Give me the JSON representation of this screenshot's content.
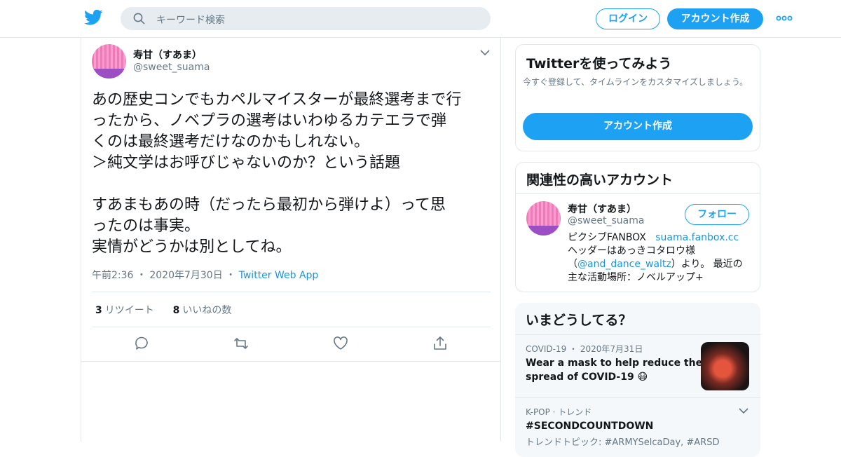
{
  "header": {
    "search_placeholder": "キーワード検索",
    "login_label": "ログイン",
    "signup_label": "アカウント作成"
  },
  "tweet": {
    "display_name": "寿甘（すあま）",
    "handle": "@sweet_suama",
    "text": "あの歴史コンでもカペルマイスターが最終選考まで行\nったから、ノベプラの選考はいわゆるカテエラで弾\nくのは最終選考だけなのかもしれない。\n＞純文学はお呼びじゃないのか？という話題\n\nすあまもあの時（だったら最初から弾けよ）って思\nったのは事実。\n実情がどうかは別としてね。",
    "time": "午前2:36",
    "date": "2020年7月30日",
    "source": "Twitter Web App",
    "retweet_count": "3",
    "retweet_label": "リツイート",
    "like_count": "8",
    "like_label": "いいねの数"
  },
  "sidebar": {
    "try": {
      "title": "Twitterを使ってみよう",
      "description": "今すぐ登録して、タイムラインをカスタマイズしましょう。",
      "button": "アカウント作成"
    },
    "related": {
      "title": "関連性の高いアカウント",
      "name": "寿甘（すあま）",
      "handle": "@sweet_suama",
      "follow_label": "フォロー",
      "bio_prefix": "ピクシブFANBOX",
      "bio_link": "suama.fanbox.cc",
      "bio_line2": "ヘッダーはあっきコタロウ様",
      "bio_open": "（",
      "bio_mention": "@and_dance_waltz",
      "bio_after_mention": "）より。 最近の",
      "bio_line4": "主な活動場所：ノベルアップ+"
    },
    "trends": {
      "title": "いまどうしてる？",
      "items": [
        {
          "category": "COVID-19",
          "date": "2020年7月31日",
          "headline_1": "Wear a mask to help reduce the",
          "headline_2": "spread of COVID-19 😷"
        },
        {
          "category": "K-POP · トレンド",
          "headline": "#SECONDCOUNTDOWN",
          "sub": "トレンドトピック: #ARMYSelcaDay, #ARSD"
        }
      ]
    }
  },
  "colors": {
    "accent": "#1da1f2",
    "link": "#1b95e0",
    "muted": "#657786",
    "border": "#e1e8ed"
  }
}
